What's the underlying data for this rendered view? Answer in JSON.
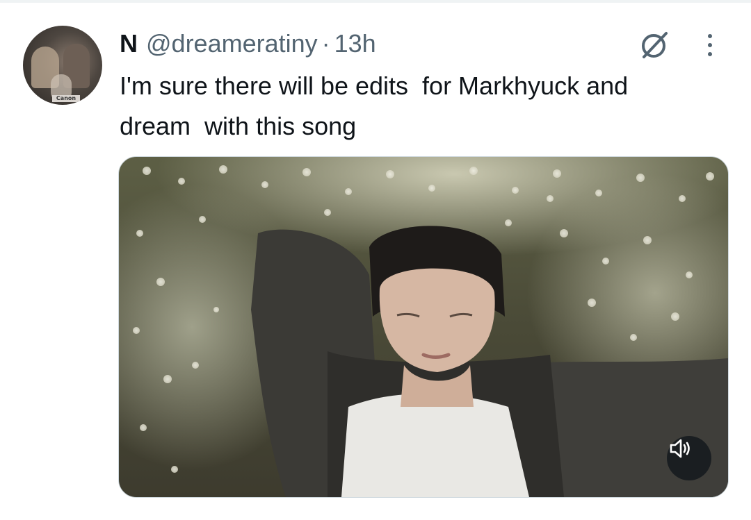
{
  "tweet": {
    "author_name": "N",
    "author_handle": "@dreameratiny",
    "separator": "·",
    "time": "13h",
    "text": "I'm sure there will be edits  for Markhyuck and\ndream  with this song"
  },
  "avatar": {
    "badge_text": "Canon"
  },
  "icons": {
    "grok": "grok-icon",
    "more": "more-vertical-icon",
    "volume": "volume-icon"
  },
  "colors": {
    "text_primary": "#0f1419",
    "text_secondary": "#536471",
    "border": "#cfd9de",
    "overlay": "#0f1419"
  }
}
